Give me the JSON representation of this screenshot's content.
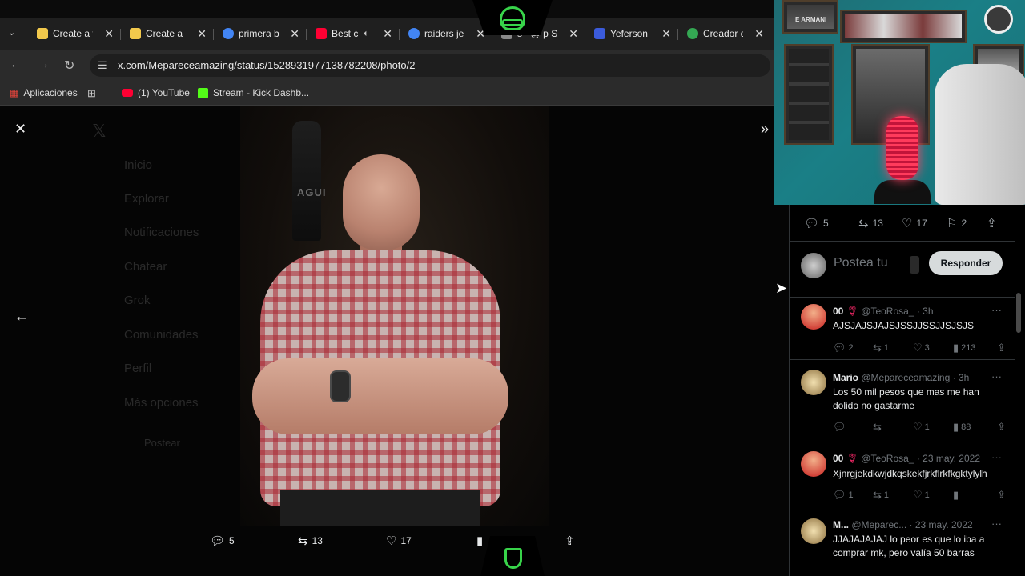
{
  "tabs": [
    {
      "title": "Create a f",
      "fav_color": "#f2c94c"
    },
    {
      "title": "Create a S",
      "fav_color": "#f2c94c"
    },
    {
      "title": "primera b",
      "fav_color": "#4285f4"
    },
    {
      "title": "Best c",
      "fav_color": "#ff0033"
    },
    {
      "title": "raiders je",
      "fav_color": "#4285f4"
    },
    {
      "title": "s · @ p S",
      "fav_color": "#888888"
    },
    {
      "title": "Yeferson",
      "fav_color": "#3b5bdb"
    },
    {
      "title": "Creador d",
      "fav_color": "#34a853"
    }
  ],
  "url": "x.com/Mepareceamazing/status/1528931977138782208/photo/2",
  "bookmarks": {
    "apps": "Aplicaciones",
    "youtube": "(1) YouTube",
    "kick": "Stream - Kick Dashb..."
  },
  "sidebar_ghost": [
    "Inicio",
    "Explorar",
    "Notificaciones",
    "Chatear",
    "Grok",
    "Comunidades",
    "Perfil",
    "Más opciones",
    "Postear"
  ],
  "photo": {
    "bottle_label": "AGUI"
  },
  "viewer_actions": {
    "replies": "5",
    "reposts": "13",
    "likes": "17"
  },
  "webcam": {
    "banner_text": "E ARMANI"
  },
  "panel": {
    "replies": "5",
    "reposts": "13",
    "likes": "17",
    "bookmarks": "2",
    "compose_placeholder": "Postea tu",
    "reply_button": "Responder"
  },
  "tweets": [
    {
      "name": "00",
      "handle": "@TeoRosa_ · 3h",
      "text": "AJSJAJSJAJSJSSJJSSJJSJSJS",
      "replies": "2",
      "reposts": "1",
      "likes": "3",
      "views": "213"
    },
    {
      "name": "Mario",
      "handle": "@Mepareceamazing · 3h",
      "text": "Los 50 mil pesos que mas me han dolido no gastarme",
      "replies": "",
      "reposts": "",
      "likes": "1",
      "views": "88"
    },
    {
      "name": "00",
      "handle": "@TeoRosa_ · 23 may. 2022",
      "text": "Xjnrgjekdkwjdkqskekfjrkflrkfkgktylylh",
      "replies": "1",
      "reposts": "1",
      "likes": "1",
      "views": ""
    },
    {
      "name": "M...",
      "handle": "@Meparec... · 23 may. 2022",
      "text": "JJAJAJAJAJ lo peor es que lo iba a comprar mk, pero valía 50 barras",
      "replies": "",
      "reposts": "",
      "likes": "",
      "views": ""
    }
  ],
  "colors": {
    "accent_green": "#38d34a",
    "panel_bg": "#000000",
    "reply_button_bg": "#d7dbdc"
  }
}
